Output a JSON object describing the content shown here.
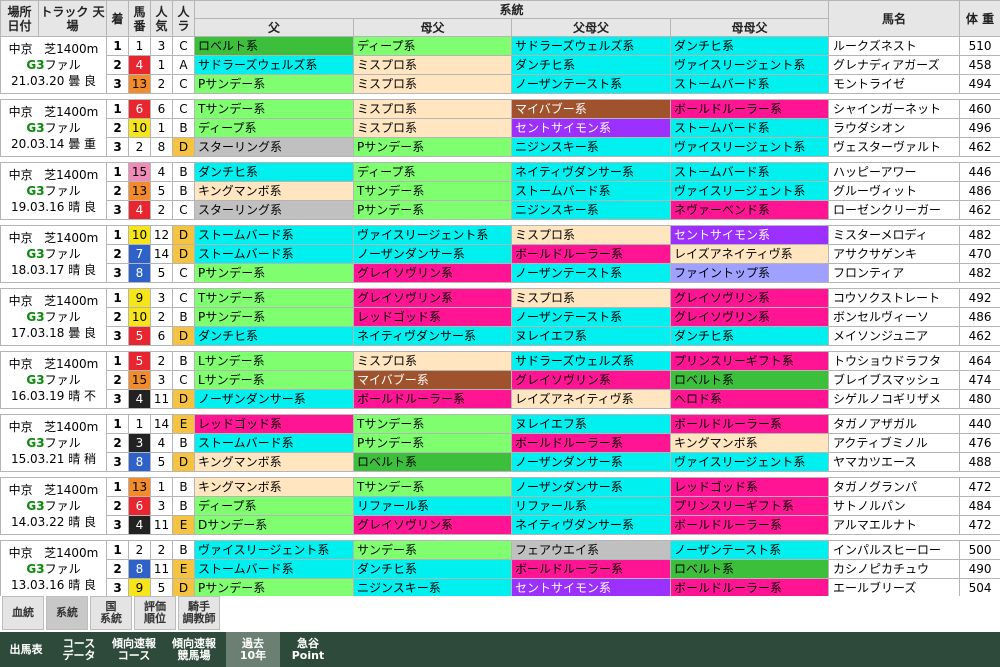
{
  "header": {
    "place_date": "場所 日付",
    "track": "トラック 天 場",
    "chaku": "着",
    "umaban": "馬 番",
    "ninki": "人 気",
    "hitora": "人 ラ",
    "keito": "系統",
    "father": "父",
    "hahachichi": "母父",
    "chichihahachichi": "父母父",
    "hahahahachichi": "母母父",
    "horse_name": "馬名",
    "weight": "体 重"
  },
  "colors": {
    "ロベルト系": "#3cc03c",
    "ディープ系": "#7fff6f",
    "サドラーズウェルズ系": "#00f0f0",
    "ダンチヒ系": "#00f0f0",
    "ミスプロ系": "#ffe6c0",
    "ヴァイスリージェント系": "#00f0f0",
    "Pサンデー系": "#7fff6f",
    "ノーザンテースト系": "#00f0f0",
    "ストームバード系": "#00f0f0",
    "Tサンデー系": "#7fff6f",
    "マイバブー系": "#a0522d",
    "ボールドルーラー系": "#ff1493",
    "セントサイモン系": "#9b30ff",
    "スターリング系": "#c0c0c0",
    "ニジンスキー系": "#00f0f0",
    "ネイティヴダンサー系": "#00f0f0",
    "キングマンボ系": "#ffe6c0",
    "ネヴァーベンド系": "#ff1493",
    "ノーザンダンサー系": "#00f0f0",
    "ファイントップ系": "#9fa0ff",
    "レイズアネイティヴ系": "#ffe6c0",
    "グレイソヴリン系": "#ff1493",
    "レッドゴッド系": "#ff1493",
    "ヌレイエフ系": "#00f0f0",
    "Lサンデー系": "#7fff6f",
    "プリンスリーギフト系": "#ff1493",
    "ヘロド系": "#ff1493",
    "リファール系": "#00f0f0",
    "Dサンデー系": "#7fff6f",
    "サンデー系": "#7fff6f",
    "フェアウエイ系": "#c0c0c0"
  },
  "races": [
    {
      "place": "中京",
      "track": "芝1400m",
      "grade": "G3",
      "kind": "ファル",
      "date": "21.03.20",
      "weather": "曇",
      "ground": "良",
      "rows": [
        {
          "chaku": "1",
          "umaban": "1",
          "waku": 1,
          "ninki": "3",
          "ra": "C",
          "f": "ロベルト系",
          "mf": "ディープ系",
          "ff": "サドラーズウェルズ系",
          "mmf": "ダンチヒ系",
          "name": "ルークズネスト",
          "wt": "510"
        },
        {
          "chaku": "2",
          "umaban": "4",
          "waku": 3,
          "ninki": "1",
          "ra": "A",
          "f": "サドラーズウェルズ系",
          "mf": "ミスプロ系",
          "ff": "ダンチヒ系",
          "mmf": "ヴァイスリージェント系",
          "name": "グレナディアガーズ",
          "wt": "458"
        },
        {
          "chaku": "3",
          "umaban": "13",
          "waku": 7,
          "ninki": "2",
          "ra": "C",
          "f": "Pサンデー系",
          "mf": "ミスプロ系",
          "ff": "ノーザンテースト系",
          "mmf": "ストームバード系",
          "name": "モントライゼ",
          "wt": "494"
        }
      ]
    },
    {
      "place": "中京",
      "track": "芝1400m",
      "grade": "G3",
      "kind": "ファル",
      "date": "20.03.14",
      "weather": "曇",
      "ground": "重",
      "rows": [
        {
          "chaku": "1",
          "umaban": "6",
          "waku": 3,
          "ninki": "6",
          "ra": "C",
          "f": "Tサンデー系",
          "mf": "ミスプロ系",
          "ff": "マイバブー系",
          "mmf": "ボールドルーラー系",
          "name": "シャインガーネット",
          "wt": "460"
        },
        {
          "chaku": "2",
          "umaban": "10",
          "waku": 5,
          "ninki": "1",
          "ra": "B",
          "f": "ディープ系",
          "mf": "ミスプロ系",
          "ff": "セントサイモン系",
          "mmf": "ストームバード系",
          "name": "ラウダシオン",
          "wt": "496"
        },
        {
          "chaku": "3",
          "umaban": "2",
          "waku": 1,
          "ninki": "8",
          "ra": "D",
          "f": "スターリング系",
          "mf": "Pサンデー系",
          "ff": "ニジンスキー系",
          "mmf": "ヴァイスリージェント系",
          "name": "ヴェスターヴァルト",
          "wt": "462"
        }
      ]
    },
    {
      "place": "中京",
      "track": "芝1400m",
      "grade": "G3",
      "kind": "ファル",
      "date": "19.03.16",
      "weather": "晴",
      "ground": "良",
      "rows": [
        {
          "chaku": "1",
          "umaban": "15",
          "waku": 8,
          "ninki": "4",
          "ra": "B",
          "f": "ダンチヒ系",
          "mf": "ディープ系",
          "ff": "ネイティヴダンサー系",
          "mmf": "ストームバード系",
          "name": "ハッピーアワー",
          "wt": "446"
        },
        {
          "chaku": "2",
          "umaban": "13",
          "waku": 7,
          "ninki": "5",
          "ra": "B",
          "f": "キングマンボ系",
          "mf": "Tサンデー系",
          "ff": "ストームバード系",
          "mmf": "ヴァイスリージェント系",
          "name": "グルーヴィット",
          "wt": "486"
        },
        {
          "chaku": "3",
          "umaban": "4",
          "waku": 3,
          "ninki": "2",
          "ra": "C",
          "f": "スターリング系",
          "mf": "Pサンデー系",
          "ff": "ニジンスキー系",
          "mmf": "ネヴァーベンド系",
          "name": "ローゼンクリーガー",
          "wt": "462"
        }
      ]
    },
    {
      "place": "中京",
      "track": "芝1400m",
      "grade": "G3",
      "kind": "ファル",
      "date": "18.03.17",
      "weather": "晴",
      "ground": "良",
      "rows": [
        {
          "chaku": "1",
          "umaban": "10",
          "waku": 5,
          "ninki": "12",
          "ra": "D",
          "f": "ストームバード系",
          "mf": "ヴァイスリージェント系",
          "ff": "ミスプロ系",
          "mmf": "セントサイモン系",
          "name": "ミスターメロディ",
          "wt": "482"
        },
        {
          "chaku": "2",
          "umaban": "7",
          "waku": 4,
          "ninki": "14",
          "ra": "D",
          "f": "ストームバード系",
          "mf": "ノーザンダンサー系",
          "ff": "ボールドルーラー系",
          "mmf": "レイズアネイティヴ系",
          "name": "アサクサゲンキ",
          "wt": "470"
        },
        {
          "chaku": "3",
          "umaban": "8",
          "waku": 4,
          "ninki": "5",
          "ra": "C",
          "f": "Pサンデー系",
          "mf": "グレイソヴリン系",
          "ff": "ノーザンテースト系",
          "mmf": "ファイントップ系",
          "name": "フロンティア",
          "wt": "482"
        }
      ]
    },
    {
      "place": "中京",
      "track": "芝1400m",
      "grade": "G3",
      "kind": "ファル",
      "date": "17.03.18",
      "weather": "曇",
      "ground": "良",
      "rows": [
        {
          "chaku": "1",
          "umaban": "9",
          "waku": 5,
          "ninki": "3",
          "ra": "C",
          "f": "Tサンデー系",
          "mf": "グレイソヴリン系",
          "ff": "ミスプロ系",
          "mmf": "グレイソヴリン系",
          "name": "コウソクストレート",
          "wt": "492"
        },
        {
          "chaku": "2",
          "umaban": "10",
          "waku": 5,
          "ninki": "2",
          "ra": "B",
          "f": "Pサンデー系",
          "mf": "レッドゴッド系",
          "ff": "ノーザンテースト系",
          "mmf": "グレイソヴリン系",
          "name": "ボンセルヴィーソ",
          "wt": "486"
        },
        {
          "chaku": "3",
          "umaban": "5",
          "waku": 3,
          "ninki": "6",
          "ra": "D",
          "f": "ダンチヒ系",
          "mf": "ネイティヴダンサー系",
          "ff": "ヌレイエフ系",
          "mmf": "ダンチヒ系",
          "name": "メイソンジュニア",
          "wt": "462"
        }
      ]
    },
    {
      "place": "中京",
      "track": "芝1400m",
      "grade": "G3",
      "kind": "ファル",
      "date": "16.03.19",
      "weather": "晴",
      "ground": "不",
      "rows": [
        {
          "chaku": "1",
          "umaban": "5",
          "waku": 3,
          "ninki": "2",
          "ra": "B",
          "f": "Lサンデー系",
          "mf": "ミスプロ系",
          "ff": "サドラーズウェルズ系",
          "mmf": "プリンスリーギフト系",
          "name": "トウショウドラフタ",
          "wt": "464"
        },
        {
          "chaku": "2",
          "umaban": "15",
          "waku": 7,
          "ninki": "3",
          "ra": "C",
          "f": "Lサンデー系",
          "mf": "マイバブー系",
          "ff": "グレイソヴリン系",
          "mmf": "ロベルト系",
          "name": "ブレイブスマッシュ",
          "wt": "474"
        },
        {
          "chaku": "3",
          "umaban": "4",
          "waku": 2,
          "ninki": "11",
          "ra": "D",
          "f": "ノーザンダンサー系",
          "mf": "ボールドルーラー系",
          "ff": "レイズアネイティヴ系",
          "mmf": "ヘロド系",
          "name": "シゲルノコギリザメ",
          "wt": "480"
        }
      ]
    },
    {
      "place": "中京",
      "track": "芝1400m",
      "grade": "G3",
      "kind": "ファル",
      "date": "15.03.21",
      "weather": "晴",
      "ground": "稍",
      "rows": [
        {
          "chaku": "1",
          "umaban": "1",
          "waku": 1,
          "ninki": "14",
          "ra": "E",
          "f": "レッドゴッド系",
          "mf": "Tサンデー系",
          "ff": "ヌレイエフ系",
          "mmf": "ボールドルーラー系",
          "name": "タガノアザガル",
          "wt": "440"
        },
        {
          "chaku": "2",
          "umaban": "3",
          "waku": 2,
          "ninki": "4",
          "ra": "B",
          "f": "ストームバード系",
          "mf": "Pサンデー系",
          "ff": "ボールドルーラー系",
          "mmf": "キングマンボ系",
          "name": "アクティブミノル",
          "wt": "476"
        },
        {
          "chaku": "3",
          "umaban": "8",
          "waku": 4,
          "ninki": "5",
          "ra": "D",
          "f": "キングマンボ系",
          "mf": "ロベルト系",
          "ff": "ノーザンダンサー系",
          "mmf": "ヴァイスリージェント系",
          "name": "ヤマカツエース",
          "wt": "488"
        }
      ]
    },
    {
      "place": "中京",
      "track": "芝1400m",
      "grade": "G3",
      "kind": "ファル",
      "date": "14.03.22",
      "weather": "晴",
      "ground": "良",
      "rows": [
        {
          "chaku": "1",
          "umaban": "13",
          "waku": 7,
          "ninki": "1",
          "ra": "B",
          "f": "キングマンボ系",
          "mf": "Tサンデー系",
          "ff": "ノーザンダンサー系",
          "mmf": "レッドゴッド系",
          "name": "タガノグランパ",
          "wt": "472"
        },
        {
          "chaku": "2",
          "umaban": "6",
          "waku": 3,
          "ninki": "3",
          "ra": "B",
          "f": "ディープ系",
          "mf": "リファール系",
          "ff": "リファール系",
          "mmf": "プリンスリーギフト系",
          "name": "サトノルパン",
          "wt": "484"
        },
        {
          "chaku": "3",
          "umaban": "4",
          "waku": 2,
          "ninki": "11",
          "ra": "E",
          "f": "Dサンデー系",
          "mf": "グレイソヴリン系",
          "ff": "ネイティヴダンサー系",
          "mmf": "ボールドルーラー系",
          "name": "アルマエルナト",
          "wt": "472"
        }
      ]
    },
    {
      "place": "中京",
      "track": "芝1400m",
      "grade": "G3",
      "kind": "ファル",
      "date": "13.03.16",
      "weather": "晴",
      "ground": "良",
      "rows": [
        {
          "chaku": "1",
          "umaban": "2",
          "waku": 1,
          "ninki": "2",
          "ra": "B",
          "f": "ヴァイスリージェント系",
          "mf": "サンデー系",
          "ff": "フェアウエイ系",
          "mmf": "ノーザンテースト系",
          "name": "インパルスヒーロー",
          "wt": "500"
        },
        {
          "chaku": "2",
          "umaban": "8",
          "waku": 4,
          "ninki": "11",
          "ra": "E",
          "f": "ストームバード系",
          "mf": "ダンチヒ系",
          "ff": "ボールドルーラー系",
          "mmf": "ロベルト系",
          "name": "カシノピカチュウ",
          "wt": "490"
        },
        {
          "chaku": "3",
          "umaban": "9",
          "waku": 5,
          "ninki": "5",
          "ra": "D",
          "f": "Pサンデー系",
          "mf": "ニジンスキー系",
          "ff": "セントサイモン系",
          "mmf": "ボールドルーラー系",
          "name": "エールブリーズ",
          "wt": "504"
        }
      ]
    }
  ],
  "tabs": [
    {
      "label": "血統",
      "active": false
    },
    {
      "label": "系統",
      "active": true
    },
    {
      "label": "国\n系統",
      "active": false
    },
    {
      "label": "評価\n順位",
      "active": false
    },
    {
      "label": "騎手\n調教師",
      "active": false
    }
  ],
  "bottom_nav": [
    {
      "label": "出馬表",
      "active": false
    },
    {
      "label": "コース\nデータ",
      "active": false
    },
    {
      "label": "傾向速報\nコース",
      "active": false
    },
    {
      "label": "傾向速報\n競馬場",
      "active": false
    },
    {
      "label": "過去\n10年",
      "active": true
    },
    {
      "label": "急谷\nPoint",
      "active": false
    }
  ]
}
